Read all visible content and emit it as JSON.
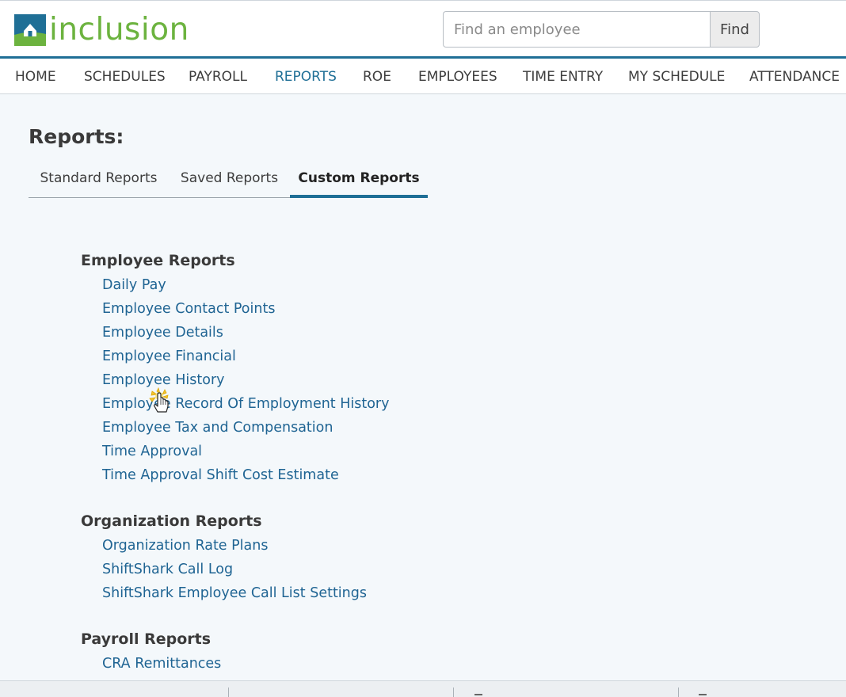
{
  "brand": {
    "name": "inclusion",
    "logo_color": "#6cb33f",
    "mark_color": "#1f6f96"
  },
  "search": {
    "placeholder": "Find an employee",
    "value": "",
    "button_label": "Find"
  },
  "nav": {
    "items": [
      {
        "label": "HOME",
        "active": false
      },
      {
        "label": "SCHEDULES",
        "active": false
      },
      {
        "label": "PAYROLL",
        "active": false
      },
      {
        "label": "REPORTS",
        "active": true
      },
      {
        "label": "ROE",
        "active": false
      },
      {
        "label": "EMPLOYEES",
        "active": false
      },
      {
        "label": "TIME ENTRY",
        "active": false
      },
      {
        "label": "MY SCHEDULE",
        "active": false
      },
      {
        "label": "ATTENDANCE",
        "active": false
      }
    ],
    "accent": "#1f6f96"
  },
  "page": {
    "title": "Reports:",
    "tabs": [
      {
        "label": "Standard Reports",
        "active": false
      },
      {
        "label": "Saved Reports",
        "active": false
      },
      {
        "label": "Custom Reports",
        "active": true
      }
    ]
  },
  "sections": [
    {
      "heading": "Employee Reports",
      "links": [
        "Daily Pay",
        "Employee Contact Points",
        "Employee Details",
        "Employee Financial",
        "Employee History",
        "Employee Record Of Employment History",
        "Employee Tax and Compensation",
        "Time Approval",
        "Time Approval Shift Cost Estimate"
      ]
    },
    {
      "heading": "Organization Reports",
      "links": [
        "Organization Rate Plans",
        "ShiftShark Call Log",
        "ShiftShark Employee Call List Settings"
      ]
    },
    {
      "heading": "Payroll Reports",
      "links": [
        "CRA Remittances"
      ]
    }
  ],
  "colors": {
    "link": "#1f6493",
    "background": "#f4f8fb"
  }
}
